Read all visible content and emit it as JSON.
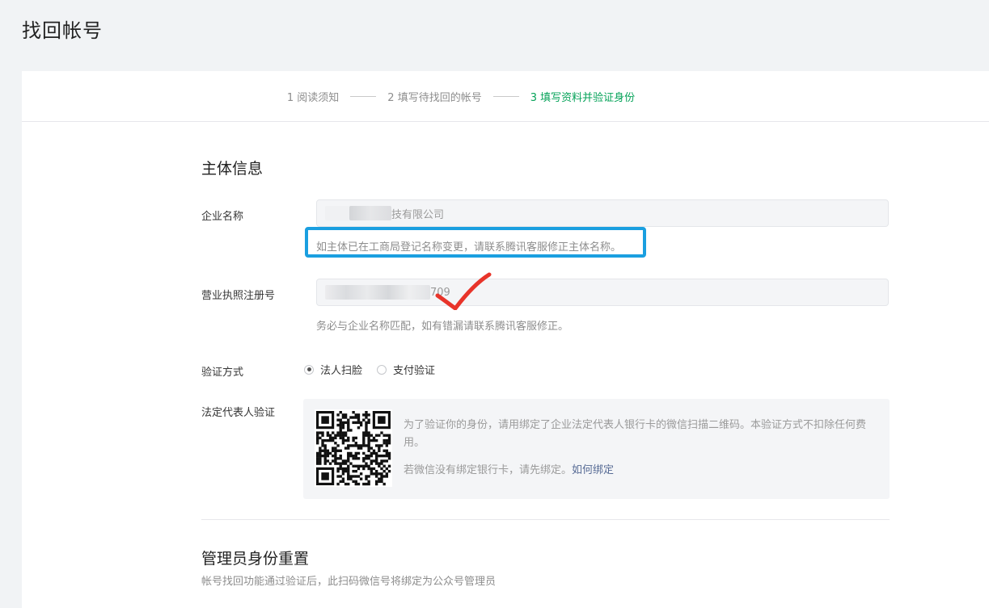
{
  "page_title": "找回帐号",
  "steps": [
    {
      "label": "1 阅读须知",
      "active": false
    },
    {
      "label": "2 填写待找回的帐号",
      "active": false
    },
    {
      "label": "3 填写资料并验证身份",
      "active": true
    }
  ],
  "subject_section": {
    "title": "主体信息",
    "company_name": {
      "label": "企业名称",
      "visible_value_suffix": "技有限公司",
      "hint": "如主体已在工商局登记名称变更，请联系腾讯客服修正主体名称。"
    },
    "license_number": {
      "label": "营业执照注册号",
      "visible_value_suffix": "709",
      "hint": "务必与企业名称匹配，如有错漏请联系腾讯客服修正。"
    },
    "verify_method": {
      "label": "验证方式",
      "options": [
        {
          "label": "法人扫脸",
          "selected": true
        },
        {
          "label": "支付验证",
          "selected": false
        }
      ]
    },
    "legal_rep": {
      "label": "法定代表人验证",
      "description": "为了验证你的身份，请用绑定了企业法定代表人银行卡的微信扫描二维码。本验证方式不扣除任何费用。",
      "bind_hint": "若微信没有绑定银行卡，请先绑定。",
      "bind_link": "如何绑定"
    }
  },
  "admin_section": {
    "title": "管理员身份重置",
    "subtitle": "帐号找回功能通过验证后，此扫码微信号将绑定为公众号管理员"
  },
  "colors": {
    "accent_green": "#07a35a",
    "highlight_blue": "#1a9fe0",
    "check_red": "#e8342a",
    "link_blue": "#576b95"
  }
}
